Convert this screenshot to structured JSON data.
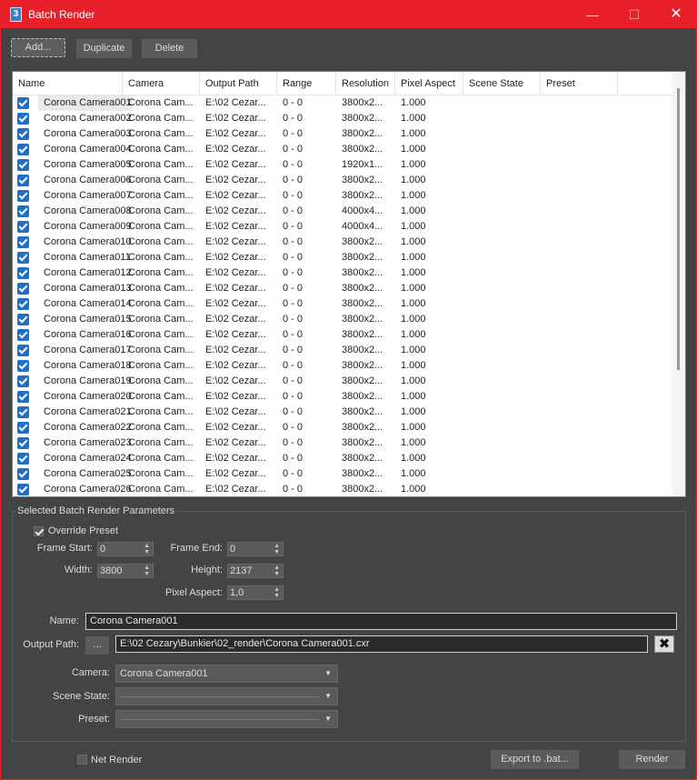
{
  "window": {
    "title": "Batch Render",
    "app_icon": "3"
  },
  "toolbar": {
    "add_label": "Add...",
    "duplicate_label": "Duplicate",
    "delete_label": "Delete"
  },
  "list": {
    "columns": [
      "Name",
      "Camera",
      "Output Path",
      "Range",
      "Resolution",
      "Pixel Aspect",
      "Scene State",
      "Preset"
    ],
    "rows": [
      {
        "name": "Corona Camera001",
        "camera": "Corona Cam...",
        "output": "E:\\02 Cezar...",
        "range": "0 - 0",
        "resolution": "3800x2...",
        "aspect": "1.000"
      },
      {
        "name": "Corona Camera002",
        "camera": "Corona Cam...",
        "output": "E:\\02 Cezar...",
        "range": "0 - 0",
        "resolution": "3800x2...",
        "aspect": "1.000"
      },
      {
        "name": "Corona Camera003",
        "camera": "Corona Cam...",
        "output": "E:\\02 Cezar...",
        "range": "0 - 0",
        "resolution": "3800x2...",
        "aspect": "1.000"
      },
      {
        "name": "Corona Camera004",
        "camera": "Corona Cam...",
        "output": "E:\\02 Cezar...",
        "range": "0 - 0",
        "resolution": "3800x2...",
        "aspect": "1.000"
      },
      {
        "name": "Corona Camera005",
        "camera": "Corona Cam...",
        "output": "E:\\02 Cezar...",
        "range": "0 - 0",
        "resolution": "1920x1...",
        "aspect": "1.000"
      },
      {
        "name": "Corona Camera006",
        "camera": "Corona Cam...",
        "output": "E:\\02 Cezar...",
        "range": "0 - 0",
        "resolution": "3800x2...",
        "aspect": "1.000"
      },
      {
        "name": "Corona Camera007",
        "camera": "Corona Cam...",
        "output": "E:\\02 Cezar...",
        "range": "0 - 0",
        "resolution": "3800x2...",
        "aspect": "1.000"
      },
      {
        "name": "Corona Camera008",
        "camera": "Corona Cam...",
        "output": "E:\\02 Cezar...",
        "range": "0 - 0",
        "resolution": "4000x4...",
        "aspect": "1.000"
      },
      {
        "name": "Corona Camera009",
        "camera": "Corona Cam...",
        "output": "E:\\02 Cezar...",
        "range": "0 - 0",
        "resolution": "4000x4...",
        "aspect": "1.000"
      },
      {
        "name": "Corona Camera010",
        "camera": "Corona Cam...",
        "output": "E:\\02 Cezar...",
        "range": "0 - 0",
        "resolution": "3800x2...",
        "aspect": "1.000"
      },
      {
        "name": "Corona Camera011",
        "camera": "Corona Cam...",
        "output": "E:\\02 Cezar...",
        "range": "0 - 0",
        "resolution": "3800x2...",
        "aspect": "1.000"
      },
      {
        "name": "Corona Camera012",
        "camera": "Corona Cam...",
        "output": "E:\\02 Cezar...",
        "range": "0 - 0",
        "resolution": "3800x2...",
        "aspect": "1.000"
      },
      {
        "name": "Corona Camera013",
        "camera": "Corona Cam...",
        "output": "E:\\02 Cezar...",
        "range": "0 - 0",
        "resolution": "3800x2...",
        "aspect": "1.000"
      },
      {
        "name": "Corona Camera014",
        "camera": "Corona Cam...",
        "output": "E:\\02 Cezar...",
        "range": "0 - 0",
        "resolution": "3800x2...",
        "aspect": "1.000"
      },
      {
        "name": "Corona Camera015",
        "camera": "Corona Cam...",
        "output": "E:\\02 Cezar...",
        "range": "0 - 0",
        "resolution": "3800x2...",
        "aspect": "1.000"
      },
      {
        "name": "Corona Camera016",
        "camera": "Corona Cam...",
        "output": "E:\\02 Cezar...",
        "range": "0 - 0",
        "resolution": "3800x2...",
        "aspect": "1.000"
      },
      {
        "name": "Corona Camera017",
        "camera": "Corona Cam...",
        "output": "E:\\02 Cezar...",
        "range": "0 - 0",
        "resolution": "3800x2...",
        "aspect": "1.000"
      },
      {
        "name": "Corona Camera018",
        "camera": "Corona Cam...",
        "output": "E:\\02 Cezar...",
        "range": "0 - 0",
        "resolution": "3800x2...",
        "aspect": "1.000"
      },
      {
        "name": "Corona Camera019",
        "camera": "Corona Cam...",
        "output": "E:\\02 Cezar...",
        "range": "0 - 0",
        "resolution": "3800x2...",
        "aspect": "1.000"
      },
      {
        "name": "Corona Camera020",
        "camera": "Corona Cam...",
        "output": "E:\\02 Cezar...",
        "range": "0 - 0",
        "resolution": "3800x2...",
        "aspect": "1.000"
      },
      {
        "name": "Corona Camera021",
        "camera": "Corona Cam...",
        "output": "E:\\02 Cezar...",
        "range": "0 - 0",
        "resolution": "3800x2...",
        "aspect": "1.000"
      },
      {
        "name": "Corona Camera022",
        "camera": "Corona Cam...",
        "output": "E:\\02 Cezar...",
        "range": "0 - 0",
        "resolution": "3800x2...",
        "aspect": "1.000"
      },
      {
        "name": "Corona Camera023",
        "camera": "Corona Cam...",
        "output": "E:\\02 Cezar...",
        "range": "0 - 0",
        "resolution": "3800x2...",
        "aspect": "1.000"
      },
      {
        "name": "Corona Camera024",
        "camera": "Corona Cam...",
        "output": "E:\\02 Cezar...",
        "range": "0 - 0",
        "resolution": "3800x2...",
        "aspect": "1.000"
      },
      {
        "name": "Corona Camera025",
        "camera": "Corona Cam...",
        "output": "E:\\02 Cezar...",
        "range": "0 - 0",
        "resolution": "3800x2...",
        "aspect": "1.000"
      },
      {
        "name": "Corona Camera026",
        "camera": "Corona Cam...",
        "output": "E:\\02 Cezar...",
        "range": "0 - 0",
        "resolution": "3800x2...",
        "aspect": "1.000"
      }
    ]
  },
  "params": {
    "group_title": "Selected Batch Render Parameters",
    "override_preset_label": "Override Preset",
    "frame_start_label": "Frame Start:",
    "frame_start": "0",
    "frame_end_label": "Frame End:",
    "frame_end": "0",
    "width_label": "Width:",
    "width": "3800",
    "height_label": "Height:",
    "height": "2137",
    "pixel_aspect_label": "Pixel Aspect:",
    "pixel_aspect": "1,0",
    "name_label": "Name:",
    "name": "Corona Camera001",
    "output_path_label": "Output Path:",
    "browse_label": "...",
    "output_path": "E:\\02 Cezary\\Bunkier\\02_render\\Corona Camera001.cxr",
    "camera_label": "Camera:",
    "camera": "Corona Camera001",
    "scene_state_label": "Scene State:",
    "preset_label": "Preset:"
  },
  "footer": {
    "net_render_label": "Net Render",
    "export_label": "Export to .bat...",
    "render_label": "Render"
  }
}
